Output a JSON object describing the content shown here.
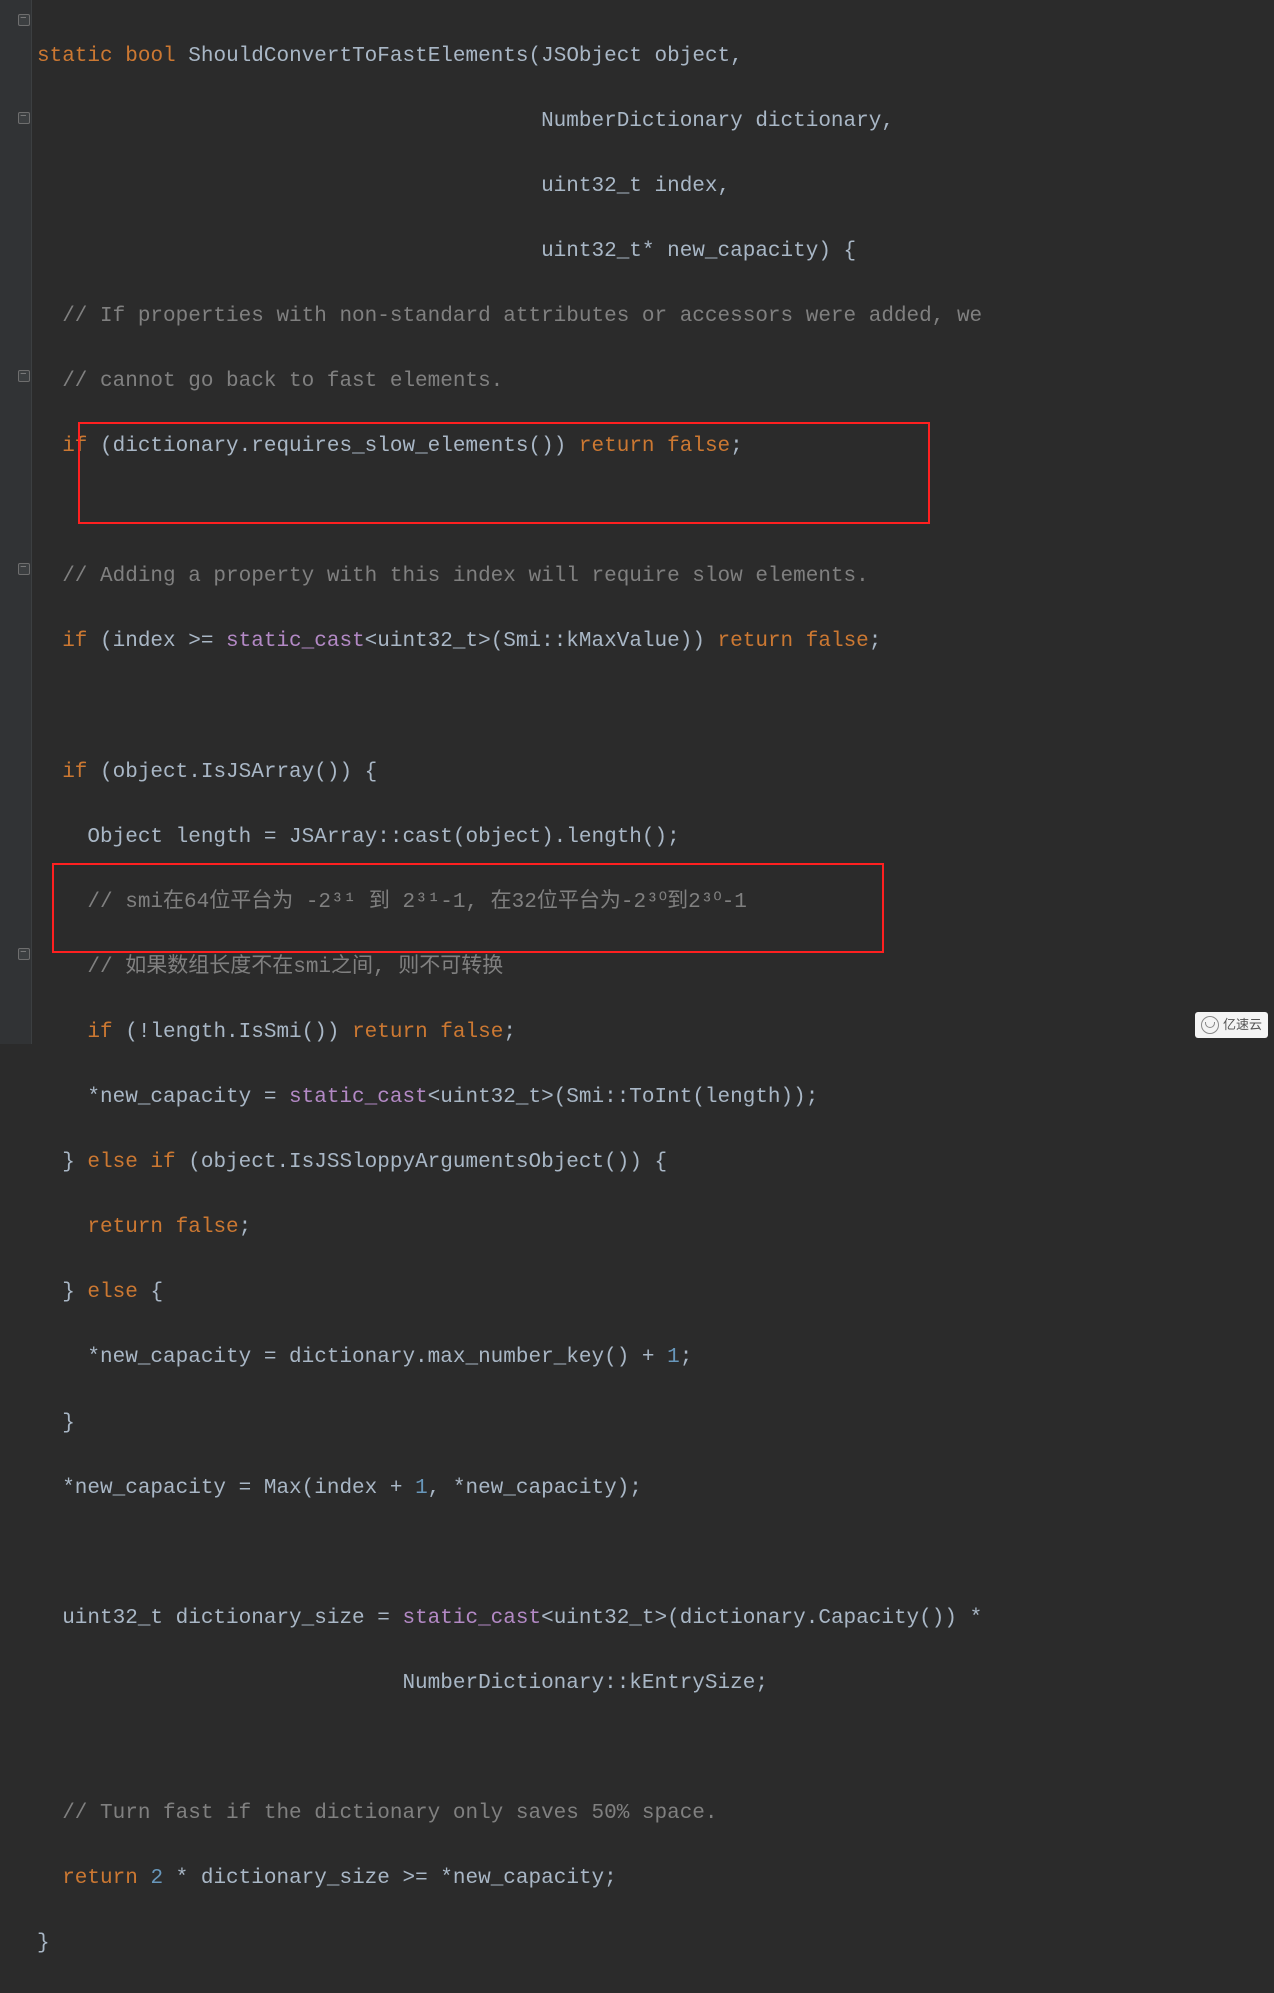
{
  "code": {
    "line1_static": "static",
    "line1_bool": "bool",
    "line1_rest": " ShouldConvertToFastElements(JSObject object,",
    "line2": "                                        NumberDictionary dictionary,",
    "line3": "                                        uint32_t index,",
    "line4": "                                        uint32_t* new_capacity) {",
    "line5": "  // If properties with non-standard attributes or accessors were added, we",
    "line6": "  // cannot go back to fast elements.",
    "line7_if": "  if",
    "line7_cond": " (dictionary.requires_slow_elements()) ",
    "line7_return": "return",
    "line7_false": " false",
    "line7_semi": ";",
    "line8": "",
    "line9": "  // Adding a property with this index will require slow elements.",
    "line10_if": "  if",
    "line10_cond1": " (index >= ",
    "line10_cast": "static_cast",
    "line10_cond2": "<uint32_t>(Smi::kMaxValue)) ",
    "line10_return": "return",
    "line10_false": " false",
    "line10_semi": ";",
    "line11": "",
    "line12_if": "  if",
    "line12_rest": " (object.IsJSArray()) {",
    "line13": "    Object length = JSArray::cast(object).length();",
    "line14": "    // smi在64位平台为 -2³¹ 到 2³¹-1, 在32位平台为-2³⁰到2³⁰-1",
    "line15": "    // 如果数组长度不在smi之间, 则不可转换",
    "line16_if": "    if",
    "line16_cond": " (!length.IsSmi()) ",
    "line16_return": "return",
    "line16_false": " false",
    "line16_semi": ";",
    "line17_a": "    *new_capacity = ",
    "line17_cast": "static_cast",
    "line17_b": "<uint32_t>(Smi::ToInt(length));",
    "line18_a": "  } ",
    "line18_else": "else if",
    "line18_b": " (object.IsJSSloppyArgumentsObject()) {",
    "line19_return": "    return",
    "line19_false": " false",
    "line19_semi": ";",
    "line20_a": "  } ",
    "line20_else": "else",
    "line20_b": " {",
    "line21_a": "    *new_capacity = dictionary.max_number_key() + ",
    "line21_num": "1",
    "line21_b": ";",
    "line22": "  }",
    "line23_a": "  *new_capacity = Max(index + ",
    "line23_num": "1",
    "line23_b": ", *new_capacity);",
    "line24": "",
    "line25_a": "  uint32_t dictionary_size = ",
    "line25_cast": "static_cast",
    "line25_b": "<uint32_t>(dictionary.Capacity()) *",
    "line26": "                             NumberDictionary::kEntrySize;",
    "line27": "",
    "line28": "  // Turn fast if the dictionary only saves 50% space.",
    "line29_return": "  return",
    "line29_sp": " ",
    "line29_num": "2",
    "line29_rest": " * dictionary_size >= *new_capacity;",
    "line30": "}"
  },
  "watermark": "亿速云"
}
